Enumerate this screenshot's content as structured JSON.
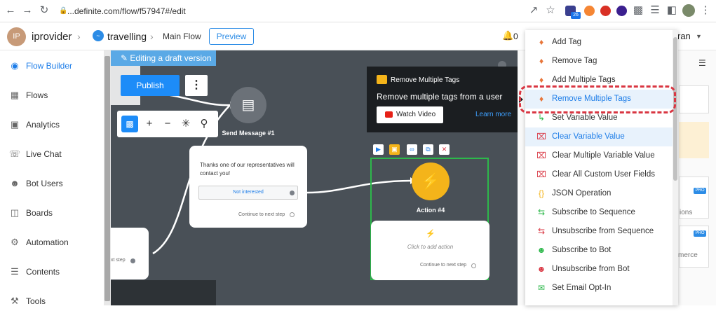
{
  "browser": {
    "url": "...definite.com/flow/f57947#/edit",
    "extensions": [
      "share-icon",
      "star-icon",
      "extension-icon-1",
      "extension-icon-2",
      "extension-icon-3",
      "extension-icon-4",
      "puzzle-icon",
      "playlist-icon",
      "sidebar-icon",
      "profile-avatar"
    ],
    "badge": "26"
  },
  "header": {
    "avatar_initials": "IP",
    "workspace": "iprovider",
    "flow_name": "travelling",
    "breadcrumb": "Main Flow",
    "preview_label": "Preview",
    "notifications_count": "0",
    "user_name_fragment": "ran"
  },
  "sidebar": {
    "items": [
      {
        "label": "Flow Builder",
        "icon": "messenger-icon",
        "active": true
      },
      {
        "label": "Flows",
        "icon": "flows-icon",
        "active": false
      },
      {
        "label": "Analytics",
        "icon": "analytics-icon",
        "active": false
      },
      {
        "label": "Live Chat",
        "icon": "headset-icon",
        "active": false
      },
      {
        "label": "Bot Users",
        "icon": "user-icon",
        "active": false
      },
      {
        "label": "Boards",
        "icon": "boards-icon",
        "active": false
      },
      {
        "label": "Automation",
        "icon": "automation-icon",
        "active": false
      },
      {
        "label": "Contents",
        "icon": "contents-icon",
        "active": false
      },
      {
        "label": "Tools",
        "icon": "tools-icon",
        "active": false
      }
    ]
  },
  "canvas": {
    "draft_label": "Editing a draft version",
    "publish_label": "Publish",
    "send_message_title": "Send Message #1",
    "message_text": "Thanks one of our representatives will contact you!",
    "button_label": "Not interested",
    "continue_label": "Continue to next step",
    "left_card_continue": "xt step",
    "action_title": "Action #4",
    "action_hint": "Click to add action",
    "action_continue": "Continue to next step"
  },
  "tooltip": {
    "title": "Remove Multiple Tags",
    "description": "Remove multiple tags from a user",
    "watch_label": "Watch Video",
    "learn_more": "Learn more"
  },
  "menu": {
    "items": [
      {
        "label": "Add Tag",
        "icon": "tag-icon"
      },
      {
        "label": "Remove Tag",
        "icon": "tag-icon"
      },
      {
        "label": "Add Multiple Tags",
        "icon": "tag-icon"
      },
      {
        "label": "Remove Multiple Tags",
        "icon": "tag-icon",
        "highlight": true
      },
      {
        "label": "Set Variable Value",
        "icon": "set-variable-icon"
      },
      {
        "label": "Clear Variable Value",
        "icon": "clear-variable-icon",
        "highlight": true
      },
      {
        "label": "Clear Multiple Variable Value",
        "icon": "clear-variable-icon"
      },
      {
        "label": "Clear All Custom User Fields",
        "icon": "clear-variable-icon"
      },
      {
        "label": "JSON Operation",
        "icon": "json-icon"
      },
      {
        "label": "Subscribe to Sequence",
        "icon": "sequence-icon"
      },
      {
        "label": "Unsubscribe from Sequence",
        "icon": "unsequence-icon"
      },
      {
        "label": "Subscribe to Bot",
        "icon": "user-add-icon"
      },
      {
        "label": "Unsubscribe from Bot",
        "icon": "user-remove-icon"
      },
      {
        "label": "Set Email Opt-In",
        "icon": "email-check-icon"
      }
    ]
  },
  "right_panel": {
    "pro_label": "PRO",
    "fragment_1": "ions",
    "fragment_2": "merce"
  },
  "colors": {
    "accent": "#1d7de8",
    "canvas_bg": "#495057",
    "action_yellow": "#f4b41a",
    "selection_green": "#2db84b",
    "highlight_red": "#d93642"
  }
}
